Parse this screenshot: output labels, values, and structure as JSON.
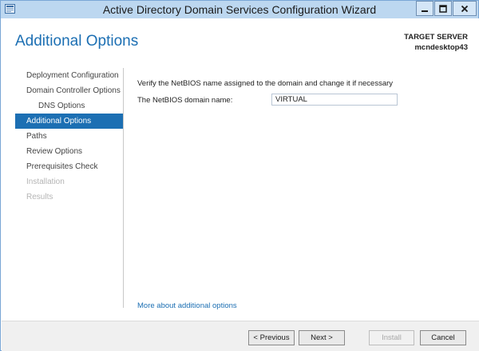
{
  "window": {
    "title": "Active Directory Domain Services Configuration Wizard",
    "icons": {
      "app": "server-manager-icon",
      "minimize": "minimize-icon",
      "maximize": "maximize-icon",
      "close": "close-icon"
    }
  },
  "header": {
    "page_title": "Additional Options",
    "target_label": "TARGET SERVER",
    "target_name": "mcndesktop43"
  },
  "nav": {
    "items": [
      {
        "label": "Deployment Configuration",
        "state": "normal"
      },
      {
        "label": "Domain Controller Options",
        "state": "normal"
      },
      {
        "label": "DNS Options",
        "state": "sub"
      },
      {
        "label": "Additional Options",
        "state": "active"
      },
      {
        "label": "Paths",
        "state": "normal"
      },
      {
        "label": "Review Options",
        "state": "normal"
      },
      {
        "label": "Prerequisites Check",
        "state": "normal"
      },
      {
        "label": "Installation",
        "state": "disabled"
      },
      {
        "label": "Results",
        "state": "disabled"
      }
    ]
  },
  "main": {
    "instruction": "Verify the NetBIOS name assigned to the domain and change it if necessary",
    "netbios_label": "The NetBIOS domain name:",
    "netbios_value": "VIRTUAL",
    "help_link": "More about additional options"
  },
  "footer": {
    "previous": "< Previous",
    "next": "Next >",
    "install": "Install",
    "cancel": "Cancel"
  },
  "colors": {
    "accent": "#1c6fb3",
    "titlebar": "#bcd7f0",
    "disabled_text": "#b5b5b5"
  }
}
